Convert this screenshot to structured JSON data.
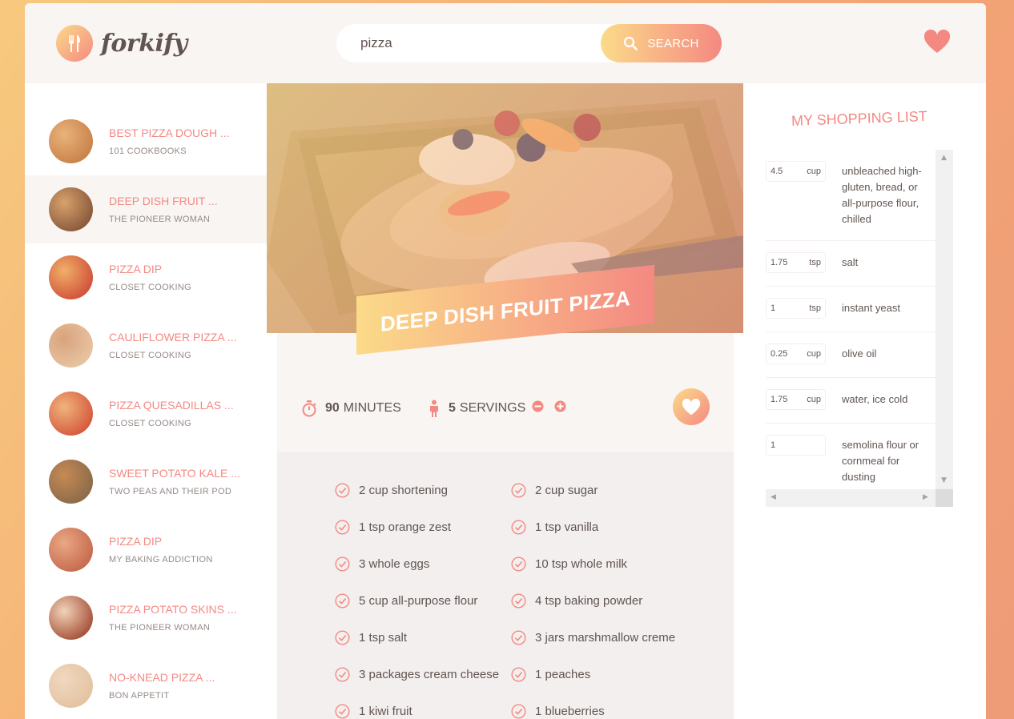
{
  "app": {
    "logo_text": "forkify"
  },
  "search": {
    "value": "pizza",
    "button_label": "SEARCH"
  },
  "results": [
    {
      "title": "BEST PIZZA DOUGH ...",
      "publisher": "101 COOKBOOKS",
      "active": false
    },
    {
      "title": "DEEP DISH FRUIT ...",
      "publisher": "THE PIONEER WOMAN",
      "active": true
    },
    {
      "title": "PIZZA DIP",
      "publisher": "CLOSET COOKING",
      "active": false
    },
    {
      "title": "CAULIFLOWER PIZZA ...",
      "publisher": "CLOSET COOKING",
      "active": false
    },
    {
      "title": "PIZZA QUESADILLAS ...",
      "publisher": "CLOSET COOKING",
      "active": false
    },
    {
      "title": "SWEET POTATO KALE ...",
      "publisher": "TWO PEAS AND THEIR POD",
      "active": false
    },
    {
      "title": "PIZZA DIP",
      "publisher": "MY BAKING ADDICTION",
      "active": false
    },
    {
      "title": "PIZZA POTATO SKINS ...",
      "publisher": "THE PIONEER WOMAN",
      "active": false
    },
    {
      "title": "NO-KNEAD PIZZA ...",
      "publisher": "BON APPETIT",
      "active": false
    }
  ],
  "recipe": {
    "title": "DEEP DISH FRUIT PIZZA",
    "time_value": "90",
    "time_unit": "MINUTES",
    "servings_value": "5",
    "servings_unit": "SERVINGS",
    "ingredients": [
      "2 cup shortening",
      "2 cup sugar",
      "1 tsp orange zest",
      "1 tsp vanilla",
      "3 whole eggs",
      "10 tsp whole milk",
      "5 cup all-purpose flour",
      "4 tsp baking powder",
      "1 tsp salt",
      "3 jars marshmallow creme",
      "3 packages cream cheese",
      "1 peaches",
      "1 kiwi fruit",
      "1 blueberries"
    ]
  },
  "shopping": {
    "title": "MY SHOPPING LIST",
    "items": [
      {
        "count": "4.5",
        "unit": "cup",
        "desc": "unbleached high-gluten, bread, or all-purpose flour, chilled"
      },
      {
        "count": "1.75",
        "unit": "tsp",
        "desc": "salt"
      },
      {
        "count": "1",
        "unit": "tsp",
        "desc": "instant yeast"
      },
      {
        "count": "0.25",
        "unit": "cup",
        "desc": "olive oil"
      },
      {
        "count": "1.75",
        "unit": "cup",
        "desc": "water, ice cold"
      },
      {
        "count": "1",
        "unit": "",
        "desc": "semolina flour or cornmeal for dusting"
      }
    ]
  },
  "colors": {
    "accent_light": "#fbdb89",
    "accent_dark": "#f48982",
    "text": "#615551",
    "muted": "#968b87",
    "panel": "#f9f5f3"
  }
}
